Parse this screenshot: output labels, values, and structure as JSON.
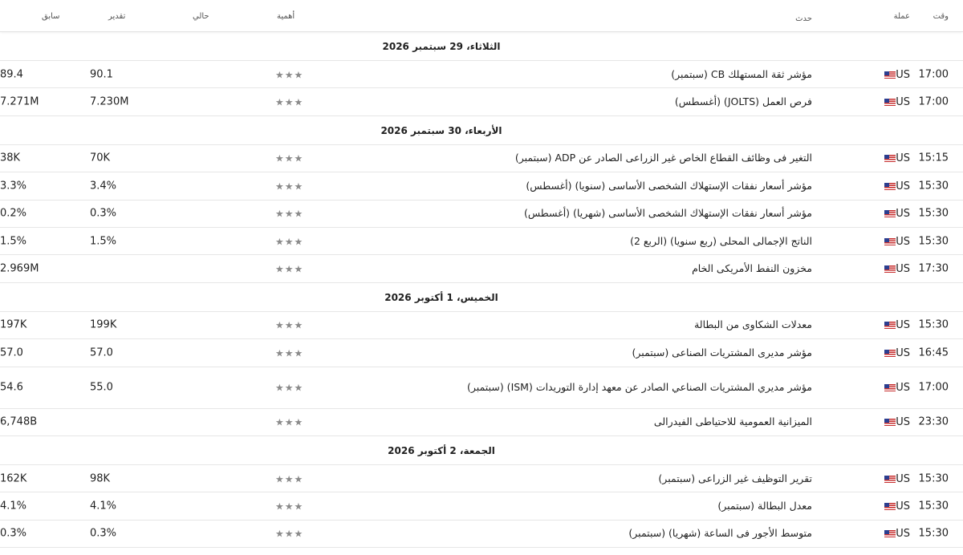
{
  "header": {
    "time": "وقت",
    "currency": "عملة",
    "event": "حدث",
    "importance": "أهمية",
    "actual": "حالي",
    "forecast": "تقدير",
    "previous": "سابق"
  },
  "icons": {
    "flag": "us-flag-icon",
    "star": "star-icon"
  },
  "groups": [
    {
      "date": "الثلاثاء، 29 سبتمبر 2026",
      "events": [
        {
          "time": "17:00",
          "currency": "US",
          "event": "مؤشر ثقة المستهلك CB  (سبتمبر)",
          "stars": "★★★",
          "actual": "",
          "forecast": "90.1",
          "previous": "89.4"
        },
        {
          "time": "17:00",
          "currency": "US",
          "event": "فرص العمل (JOLTS)  (أغسطس)",
          "stars": "★★★",
          "actual": "",
          "forecast": "7.230M",
          "previous": "7.271M"
        }
      ]
    },
    {
      "date": "الأربعاء، 30 سبتمبر 2026",
      "events": [
        {
          "time": "15:15",
          "currency": "US",
          "event": "التغير فى وظائف القطاع الخاص غير الزراعى الصادر عن ADP  (سبتمبر)",
          "stars": "★★★",
          "actual": "",
          "forecast": "70K",
          "previous": "38K"
        },
        {
          "time": "15:30",
          "currency": "US",
          "event": "مؤشر أسعار نفقات الإستهلاك الشخصى الأساسى (سنويا) (أغسطس)",
          "stars": "★★★",
          "actual": "",
          "forecast": "3.4%",
          "previous": "3.3%"
        },
        {
          "time": "15:30",
          "currency": "US",
          "event": "مؤشر أسعار نفقات الإستهلاك الشخصى الأساسى (شهريا) (أغسطس)",
          "stars": "★★★",
          "actual": "",
          "forecast": "0.3%",
          "previous": "0.2%"
        },
        {
          "time": "15:30",
          "currency": "US",
          "event": "الناتج الإجمالى المحلى (ربع سنويا) (الربع 2)",
          "stars": "★★★",
          "actual": "",
          "forecast": "1.5%",
          "previous": "1.5%"
        },
        {
          "time": "17:30",
          "currency": "US",
          "event": "مخزون النفط الأمريكى الخام",
          "stars": "★★★",
          "actual": "",
          "forecast": "",
          "previous": "2.969M"
        }
      ]
    },
    {
      "date": "الخميس، 1 أكتوبر 2026",
      "events": [
        {
          "time": "15:30",
          "currency": "US",
          "event": "معدلات الشكاوى من البطالة",
          "stars": "★★★",
          "actual": "",
          "forecast": "199K",
          "previous": "197K"
        },
        {
          "time": "16:45",
          "currency": "US",
          "event": "مؤشر مديرى المشتريات الصناعى  (سبتمبر)",
          "stars": "★★★",
          "actual": "",
          "forecast": "57.0",
          "previous": "57.0"
        },
        {
          "time": "17:00",
          "currency": "US",
          "event": "مؤشر مديري المشتريات الصناعي الصادر عن معهد إدارة التوريدات (ISM)  (سبتمبر)",
          "stars": "★★★",
          "actual": "",
          "forecast": "55.0",
          "previous": "54.6",
          "tall": true
        },
        {
          "time": "23:30",
          "currency": "US",
          "event": "الميزانية العمومية للاحتياطى الفيدرالى",
          "stars": "★★★",
          "actual": "",
          "forecast": "",
          "previous": "6,748B"
        }
      ]
    },
    {
      "date": "الجمعة، 2 أكتوبر 2026",
      "events": [
        {
          "time": "15:30",
          "currency": "US",
          "event": "تقرير التوظيف غير الزراعى  (سبتمبر)",
          "stars": "★★★",
          "actual": "",
          "forecast": "98K",
          "previous": "162K"
        },
        {
          "time": "15:30",
          "currency": "US",
          "event": "معدل البطالة  (سبتمبر)",
          "stars": "★★★",
          "actual": "",
          "forecast": "4.1%",
          "previous": "4.1%"
        },
        {
          "time": "15:30",
          "currency": "US",
          "event": "متوسط الأجور فى الساعة (شهريا) (سبتمبر)",
          "stars": "★★★",
          "actual": "",
          "forecast": "0.3%",
          "previous": "0.3%"
        }
      ]
    }
  ]
}
